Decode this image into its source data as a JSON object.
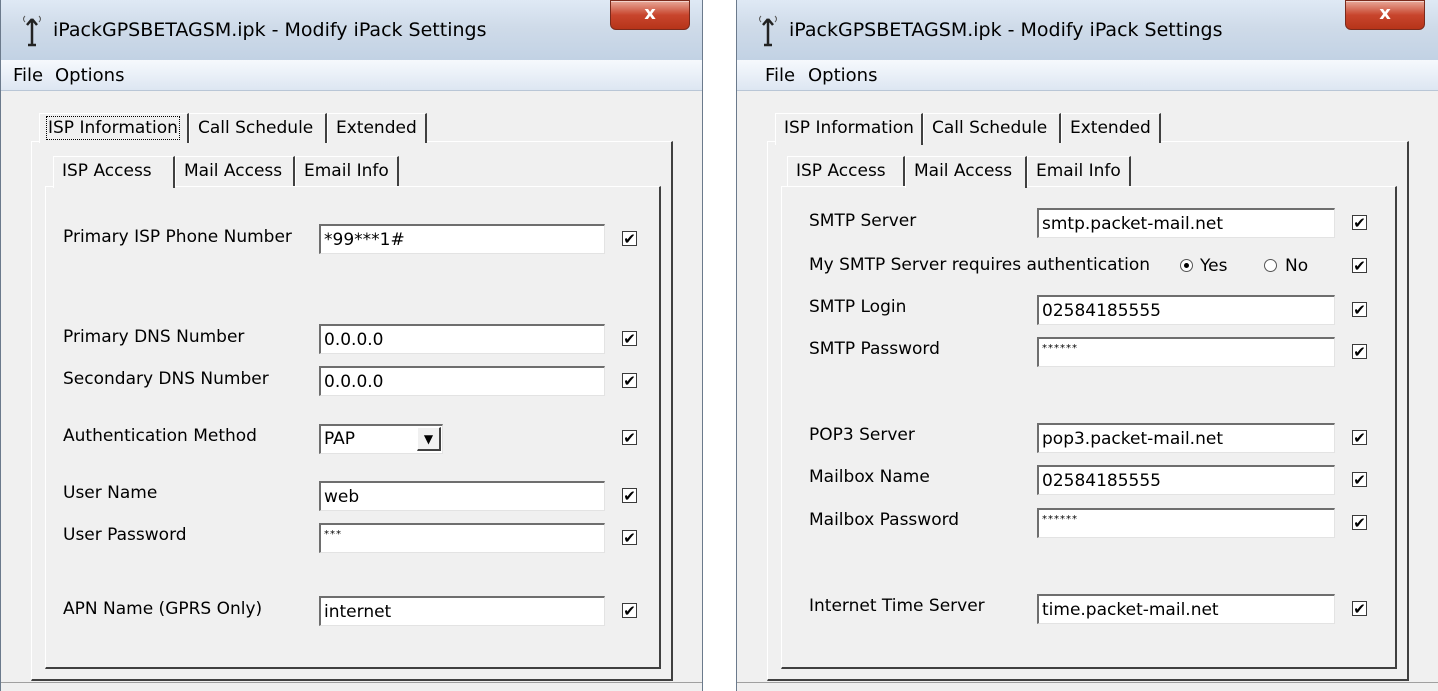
{
  "left_window": {
    "title": "iPackGPSBETAGSM.ipk - Modify iPack Settings",
    "close_label": "x",
    "menu": {
      "file": "File",
      "options": "Options"
    },
    "tabs": [
      "ISP Information",
      "Call Schedule",
      "Extended"
    ],
    "subtabs": [
      "ISP Access",
      "Mail Access",
      "Email Info"
    ],
    "fields": {
      "primary_isp_phone": {
        "label": "Primary ISP Phone Number",
        "value": "*99***1#",
        "checked": true
      },
      "primary_dns": {
        "label": "Primary DNS Number",
        "value": "0.0.0.0",
        "checked": true
      },
      "secondary_dns": {
        "label": "Secondary DNS Number",
        "value": "0.0.0.0",
        "checked": true
      },
      "auth_method": {
        "label": "Authentication Method",
        "value": "PAP",
        "checked": true
      },
      "user_name": {
        "label": "User Name",
        "value": "web",
        "checked": true
      },
      "user_password": {
        "label": "User Password",
        "value": "***",
        "checked": true
      },
      "apn_name": {
        "label": "APN Name (GPRS Only)",
        "value": "internet",
        "checked": true
      }
    }
  },
  "right_window": {
    "title": "iPackGPSBETAGSM.ipk - Modify iPack Settings",
    "close_label": "x",
    "menu": {
      "file": "File",
      "options": "Options"
    },
    "tabs": [
      "ISP Information",
      "Call Schedule",
      "Extended"
    ],
    "subtabs": [
      "ISP Access",
      "Mail Access",
      "Email Info"
    ],
    "fields": {
      "smtp_server": {
        "label": "SMTP Server",
        "value": "smtp.packet-mail.net",
        "checked": true
      },
      "smtp_auth": {
        "label": "My SMTP Server requires authentication",
        "yes": "Yes",
        "no": "No",
        "selected": "Yes",
        "checked": true
      },
      "smtp_login": {
        "label": "SMTP Login",
        "value": "02584185555",
        "checked": true
      },
      "smtp_password": {
        "label": "SMTP Password",
        "value": "******",
        "checked": true
      },
      "pop3_server": {
        "label": "POP3 Server",
        "value": "pop3.packet-mail.net",
        "checked": true
      },
      "mailbox_name": {
        "label": "Mailbox Name",
        "value": "02584185555",
        "checked": true
      },
      "mailbox_password": {
        "label": "Mailbox Password",
        "value": "******",
        "checked": true
      },
      "internet_time_server": {
        "label": "Internet Time Server",
        "value": "time.packet-mail.net",
        "checked": true
      }
    }
  },
  "check_glyph": "✔"
}
